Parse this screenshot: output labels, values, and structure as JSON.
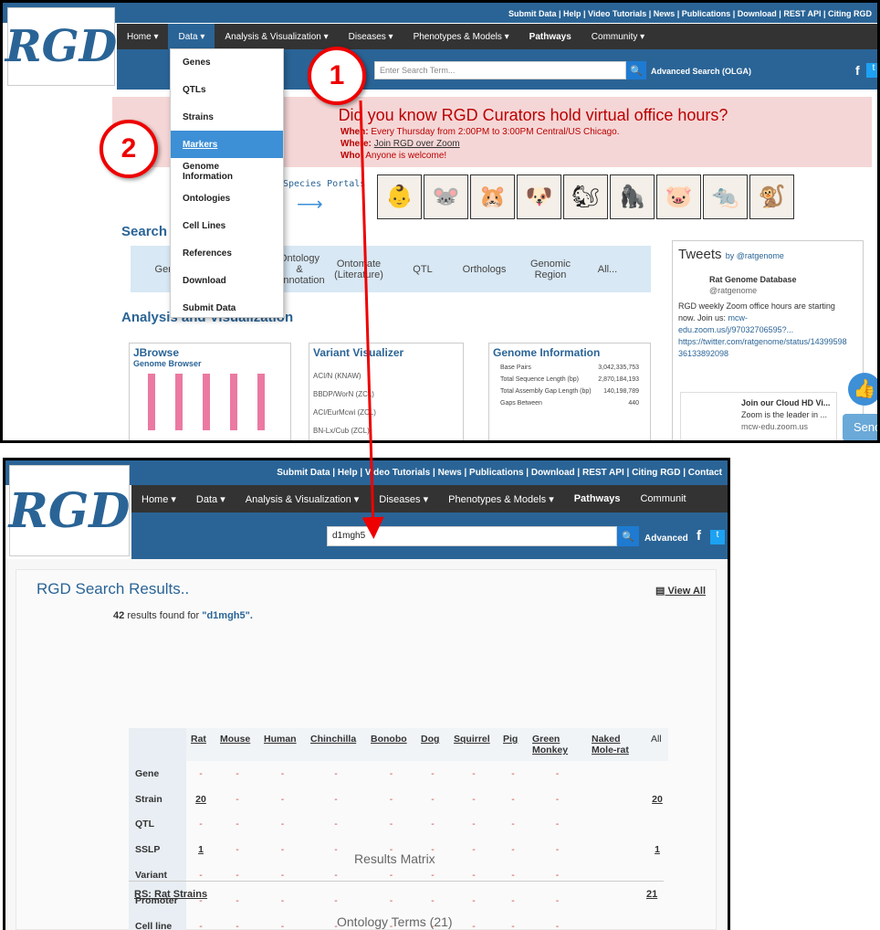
{
  "top_panel": {
    "top_links": "Submit Data | Help | Video Tutorials | News | Publications | Download | REST API | Citing RGD",
    "logo": "RGD",
    "nav": [
      "Home ▾",
      "Data ▾",
      "Analysis & Visualization ▾",
      "Diseases ▾",
      "Phenotypes & Models ▾",
      "Pathways",
      "Community ▾"
    ],
    "search_placeholder": "Enter Search Term...",
    "advanced": "Advanced Search (OLGA)",
    "dropdown": [
      "Genes",
      "QTLs",
      "Strains",
      "Markers",
      "Genome Information",
      "Ontologies",
      "Cell Lines",
      "References",
      "Download",
      "Submit Data"
    ],
    "banner_title": "Did you know RGD Curators hold virtual office hours?",
    "banner_when_label": "When:",
    "banner_when": "Every Thursday from 2:00PM to 3:00PM Central/US Chicago.",
    "banner_where_label": "Where:",
    "banner_where": "Join RGD over Zoom",
    "banner_who_label": "Who:",
    "banner_who": "Anyone is welcome!",
    "species_portals": "Species Portals",
    "search_title": "Search",
    "ribbon": [
      "Gene",
      "Ontology & Annotation",
      "Ontomate (Literature)",
      "QTL",
      "Orthologs",
      "Genomic Region",
      "All..."
    ],
    "analysis_title": "Analysis and Visualization",
    "jbrowse_title": "JBrowse",
    "jbrowse_sub": "Genome Browser",
    "variant_title": "Variant Visualizer",
    "variant_rows": [
      "ACI/N (KNAW)",
      "BBDP/WorN (ZCL)",
      "ACI/EurMcwi (ZCL)",
      "BN-Lx/Cub (ZCL)"
    ],
    "genome_title": "Genome Information",
    "genome_rows": [
      [
        "Base Pairs",
        "3,042,335,753"
      ],
      [
        "Total Sequence Length (bp)",
        "2,870,184,193"
      ],
      [
        "Total Assembly Gap Length (bp)",
        "140,198,789"
      ],
      [
        "Gaps Between",
        "440"
      ]
    ],
    "tweets_title": "Tweets",
    "tweets_by": "by @ratgenome",
    "tweet_name": "Rat Genome Database",
    "tweet_handle": "@ratgenome",
    "tweet_text": "RGD weekly Zoom office hours are starting now. Join us:",
    "tweet_link1": "mcw-edu.zoom.us/j/97032706595?...",
    "tweet_link2": "https://twitter.com/ratgenome/status/1439959836133892098",
    "card_title": "Join our Cloud HD Vi...",
    "card_text": "Zoom is the leader in ...",
    "card_link": "mcw-edu.zoom.us",
    "send": "Send",
    "marker1": "1",
    "marker2": "2"
  },
  "bottom_panel": {
    "top_links": "Submit Data | Help | Video Tutorials | News | Publications | Download | REST API | Citing RGD | Contact",
    "nav": [
      "Home ▾",
      "Data ▾",
      "Analysis & Visualization ▾",
      "Diseases ▾",
      "Phenotypes & Models ▾",
      "Pathways",
      "Communit"
    ],
    "search_value": "d1mgh5",
    "advanced": "Advanced",
    "results_title": "RGD Search Results..",
    "view_all": "View All",
    "count": "42",
    "found_text": "results found for",
    "query": "\"d1mgh5\".",
    "columns": [
      "Rat",
      "Mouse",
      "Human",
      "Chinchilla",
      "Bonobo",
      "Dog",
      "Squirrel",
      "Pig",
      "Green Monkey",
      "Naked Mole-rat",
      "All"
    ],
    "rows": [
      {
        "label": "Gene",
        "cells": [
          "-",
          "-",
          "-",
          "-",
          "-",
          "-",
          "-",
          "-",
          "-",
          "",
          ""
        ]
      },
      {
        "label": "Strain",
        "cells": [
          "20",
          "-",
          "-",
          "-",
          "-",
          "-",
          "-",
          "-",
          "-",
          "",
          "20"
        ]
      },
      {
        "label": "QTL",
        "cells": [
          "-",
          "-",
          "-",
          "-",
          "-",
          "-",
          "-",
          "-",
          "-",
          "",
          ""
        ]
      },
      {
        "label": "SSLP",
        "cells": [
          "1",
          "-",
          "-",
          "-",
          "-",
          "-",
          "-",
          "-",
          "-",
          "",
          "1"
        ]
      },
      {
        "label": "Variant",
        "cells": [
          "-",
          "-",
          "-",
          "-",
          "-",
          "-",
          "-",
          "-",
          "-",
          "",
          ""
        ]
      },
      {
        "label": "Promoter",
        "cells": [
          "-",
          "-",
          "-",
          "-",
          "-",
          "-",
          "-",
          "-",
          "-",
          "",
          ""
        ]
      },
      {
        "label": "Cell line",
        "cells": [
          "-",
          "-",
          "-",
          "-",
          "-",
          "-",
          "-",
          "-",
          "-",
          "",
          ""
        ]
      }
    ],
    "matrix_label": "Results Matrix",
    "rs_label": "RS: Rat Strains",
    "rs_count": "21",
    "ontology_label": "Ontology Terms (21)"
  },
  "colors": {
    "brand": "#2a6496",
    "nav": "#333333",
    "highlight": "#3d8fd6",
    "annotation": "#ee0000"
  },
  "icons": [
    "search-icon",
    "facebook-icon",
    "twitter-icon",
    "thumbs-up-icon",
    "arrow-icon"
  ]
}
